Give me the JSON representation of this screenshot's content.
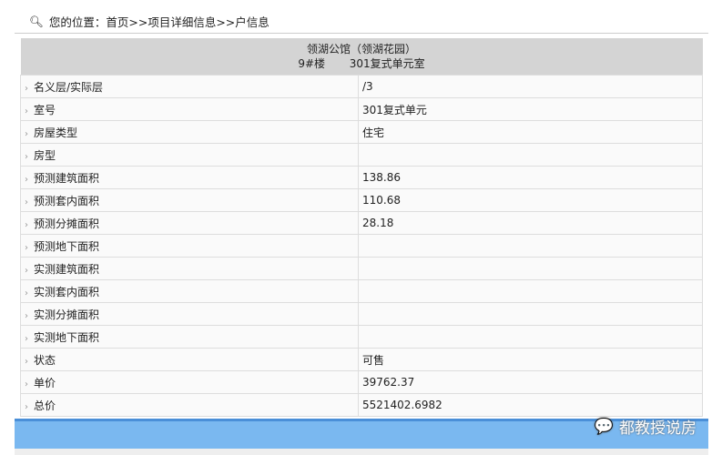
{
  "breadcrumb": {
    "label": "您的位置：",
    "path": "首页>>项目详细信息>>户信息"
  },
  "header": {
    "project": "领湖公馆（领湖花园）",
    "building": "9#楼",
    "room": "301复式单元室"
  },
  "rows": [
    {
      "k": "名义层/实际层",
      "v": "/3"
    },
    {
      "k": "室号",
      "v": "301复式单元"
    },
    {
      "k": "房屋类型",
      "v": "住宅"
    },
    {
      "k": "房型",
      "v": ""
    },
    {
      "k": "预测建筑面积",
      "v": "138.86"
    },
    {
      "k": "预测套内面积",
      "v": "110.68"
    },
    {
      "k": "预测分摊面积",
      "v": "28.18"
    },
    {
      "k": "预测地下面积",
      "v": ""
    },
    {
      "k": "实测建筑面积",
      "v": ""
    },
    {
      "k": "实测套内面积",
      "v": ""
    },
    {
      "k": "实测分摊面积",
      "v": ""
    },
    {
      "k": "实测地下面积",
      "v": ""
    },
    {
      "k": "状态",
      "v": "可售"
    },
    {
      "k": "单价",
      "v": "39762.37"
    },
    {
      "k": "总价",
      "v": "5521402.6982"
    }
  ],
  "watermark": "都教授说房"
}
